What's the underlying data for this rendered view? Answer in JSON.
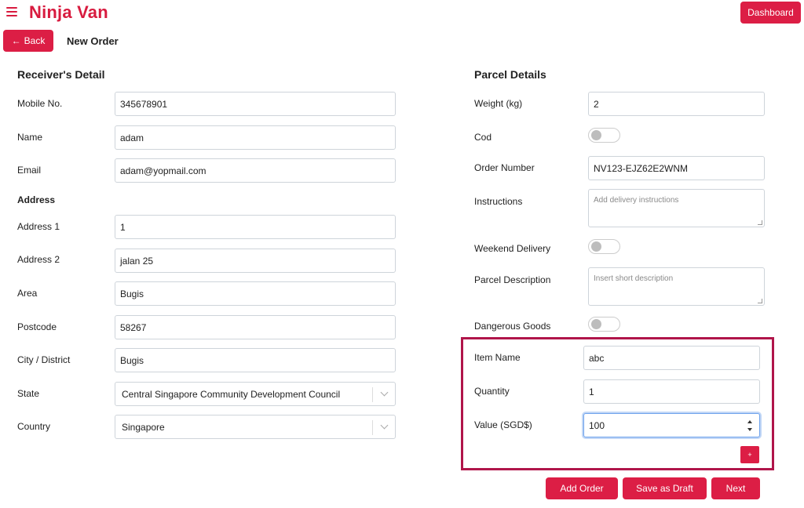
{
  "header": {
    "menu_icon": "hamburger-icon",
    "brand": "Ninja Van",
    "dashboard_label": "Dashboard",
    "back_label": "Back",
    "back_icon": "arrow-left-icon",
    "page_title": "New Order"
  },
  "receiver": {
    "title": "Receiver's Detail",
    "mobile": {
      "label": "Mobile No.",
      "value": "345678901"
    },
    "name": {
      "label": "Name",
      "value": "adam"
    },
    "email": {
      "label": "Email",
      "value": "adam@yopmail.com"
    },
    "address_title": "Address",
    "address1": {
      "label": "Address 1",
      "value": "1"
    },
    "address2": {
      "label": "Address 2",
      "value": "jalan 25"
    },
    "area": {
      "label": "Area",
      "value": "Bugis"
    },
    "postcode": {
      "label": "Postcode",
      "value": "58267"
    },
    "city": {
      "label": "City / District",
      "value": "Bugis"
    },
    "state": {
      "label": "State",
      "value": "Central Singapore Community Development Council"
    },
    "country": {
      "label": "Country",
      "value": "Singapore"
    }
  },
  "parcel": {
    "title": "Parcel Details",
    "weight": {
      "label": "Weight (kg)",
      "value": "2"
    },
    "cod": {
      "label": "Cod",
      "on": false
    },
    "order_number": {
      "label": "Order Number",
      "value": "NV123-EJZ62E2WNM"
    },
    "instructions": {
      "label": "Instructions",
      "placeholder": "Add delivery instructions"
    },
    "weekend": {
      "label": "Weekend Delivery",
      "on": false
    },
    "description": {
      "label": "Parcel Description",
      "placeholder": "Insert short description"
    },
    "dangerous": {
      "label": "Dangerous Goods",
      "on": false
    }
  },
  "item": {
    "name": {
      "label": "Item Name",
      "value": "abc"
    },
    "quantity": {
      "label": "Quantity",
      "value": "1"
    },
    "value": {
      "label": "Value (SGD$)",
      "value": "100"
    },
    "add_label": "+"
  },
  "actions": {
    "add_order": "Add Order",
    "save_draft": "Save as Draft",
    "next": "Next"
  },
  "colors": {
    "brand": "#d81b3f",
    "button": "#dc1e45",
    "highlight": "#b0154a"
  }
}
